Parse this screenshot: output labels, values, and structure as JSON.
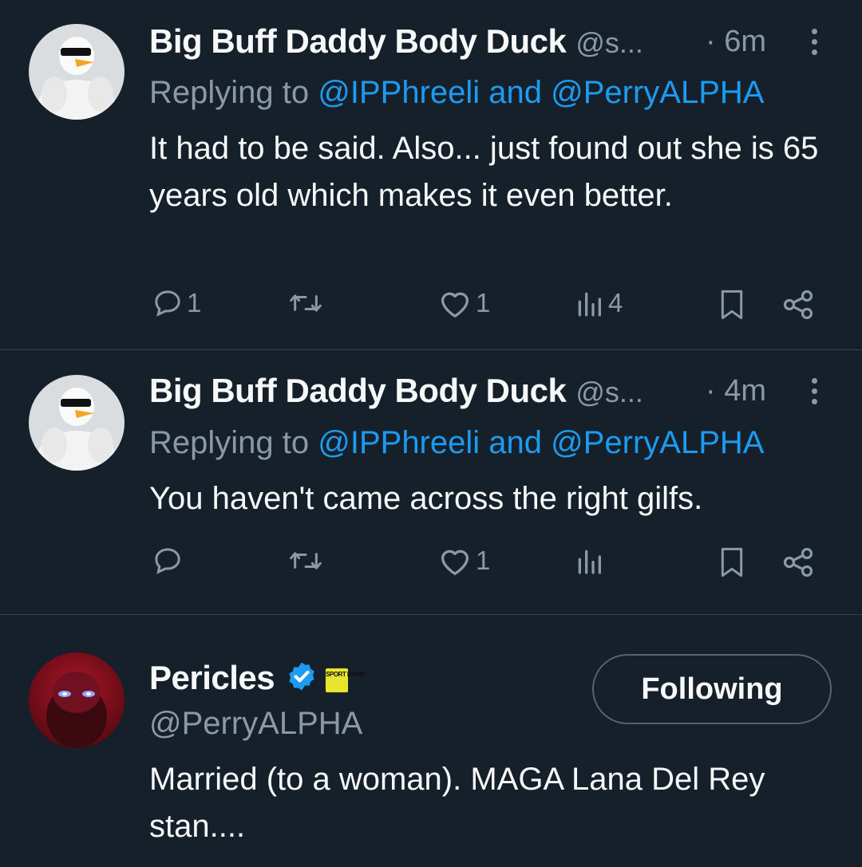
{
  "tweets": [
    {
      "display_name": "Big Buff Daddy Body Duck",
      "handle": "@s...",
      "time": "· 6m",
      "replying_prefix": "Replying to ",
      "replying_users": "@IPPhreeli and @PerryALPHA",
      "text": "It had to be said. Also... just found out she is 65 years old which makes it even better.",
      "avatar_icon": "duck-sunglasses-avatar",
      "actions": {
        "replies": "1",
        "retweets": "",
        "likes": "1",
        "views": "4"
      }
    },
    {
      "display_name": "Big Buff Daddy Body Duck",
      "handle": "@s...",
      "time": "· 4m",
      "replying_prefix": "Replying to ",
      "replying_users": "@IPPhreeli and @PerryALPHA",
      "text": "You haven't came across the right gilfs.",
      "avatar_icon": "duck-sunglasses-avatar",
      "actions": {
        "replies": "",
        "retweets": "",
        "likes": "1",
        "views": ""
      }
    }
  ],
  "profile": {
    "display_name": "Pericles",
    "handle": "@PerryALPHA",
    "verified": true,
    "affiliate_badge_text": "SPORT DRINK",
    "bio": "Married (to a woman). MAGA Lana Del Rey stan....",
    "follow_button_label": "Following",
    "avatar_icon": "red-glowing-eyes-avatar"
  },
  "colors": {
    "background": "#15202b",
    "text": "#f7f9f9",
    "muted": "#8b98a5",
    "link": "#1d9bf0",
    "separator": "#38444d"
  }
}
